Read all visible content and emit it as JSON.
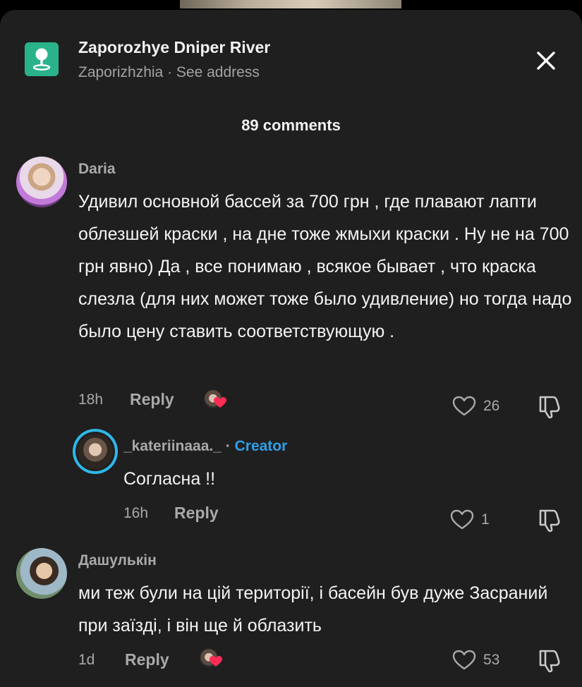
{
  "location": {
    "title": "Zaporozhye Dniper River",
    "city": "Zaporizhzhia",
    "separator": " · ",
    "see_address": "See address"
  },
  "comments_count": "89 comments",
  "comments": [
    {
      "username": "Daria",
      "text": "Удивил основной бассей за 700 грн , где плавают лапти облезшей краски , на дне тоже жмыхи краски . Ну не на 700 грн явно) Да , все понимаю , всякое бывает , что краска слезла (для них может тоже было удивление) но тогда надо было цену ставить соответствующую .",
      "time": "18h",
      "reply_label": "Reply",
      "likes": "26"
    },
    {
      "username": "_kateriinaaa._",
      "badge_sep": " · ",
      "badge": "Creator",
      "text": "Согласна !!",
      "time": "16h",
      "reply_label": "Reply",
      "likes": "1"
    },
    {
      "username": "Дашулькін",
      "text": "ми теж були на цій території, і басейн був дуже Засраний при заїзді, і він ще й облазить",
      "time": "1d",
      "reply_label": "Reply",
      "likes": "53"
    }
  ],
  "colors": {
    "sheet_bg": "#1f1f1f",
    "location_icon_bg": "#2ab38b",
    "creator_badge": "#2f9fe8",
    "creator_ring": "#2fb7e8",
    "heart_reaction": "#fe2c55"
  },
  "icons": [
    "map-pin-icon",
    "close-icon",
    "heart-icon",
    "dislike-icon",
    "creator-heart-reaction-icon"
  ]
}
